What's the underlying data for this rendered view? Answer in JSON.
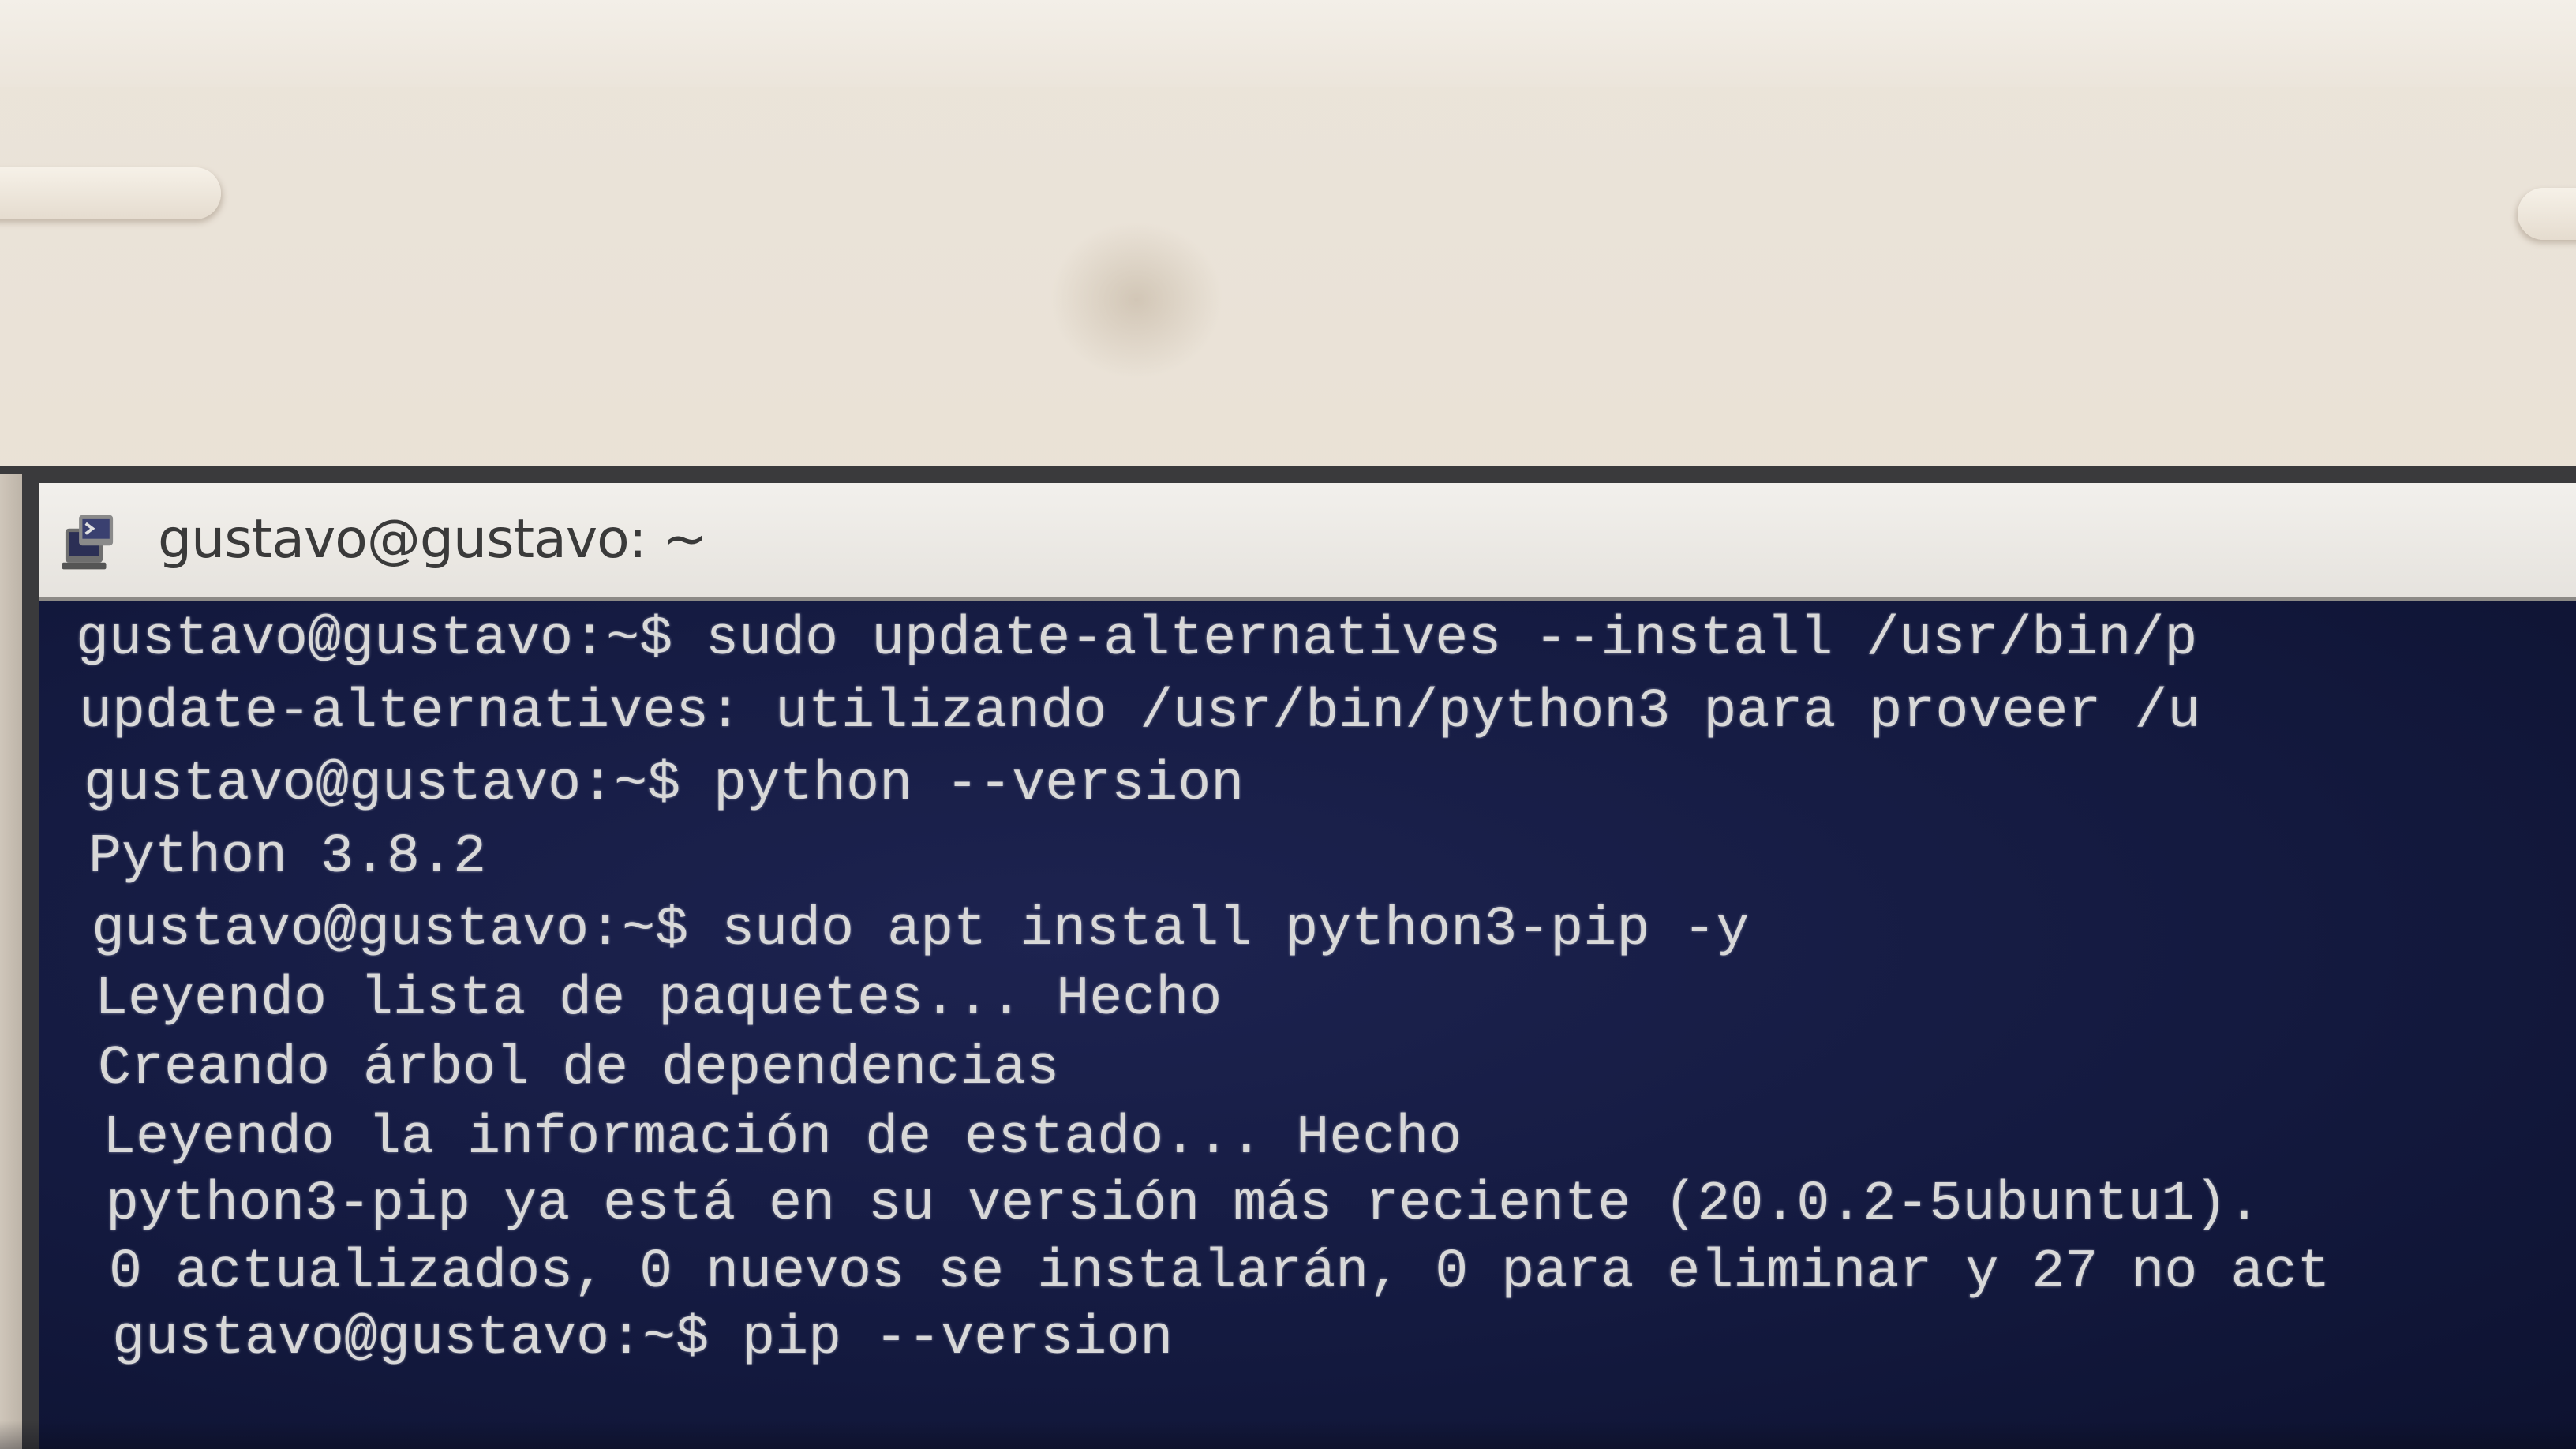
{
  "window": {
    "title": "gustavo@gustavo: ~",
    "icon": "terminal-app-icon"
  },
  "terminal": {
    "lines": [
      "gustavo@gustavo:~$ sudo update-alternatives --install /usr/bin/p",
      "update-alternatives: utilizando /usr/bin/python3 para proveer /u",
      "gustavo@gustavo:~$ python --version",
      "Python 3.8.2",
      "gustavo@gustavo:~$ sudo apt install python3-pip -y",
      "Leyendo lista de paquetes... Hecho",
      "Creando árbol de dependencias",
      "Leyendo la información de estado... Hecho",
      "python3-pip ya está en su versión más reciente (20.0.2-5ubuntu1).",
      "0 actualizados, 0 nuevos se instalarán, 0 para eliminar y 27 no act",
      "gustavo@gustavo:~$ pip --version"
    ]
  },
  "colors": {
    "terminal_background": "#161a3a",
    "terminal_text": "#d8d8d8",
    "titlebar_background": "#eeebe6",
    "bezel": "#e9e1d5"
  }
}
